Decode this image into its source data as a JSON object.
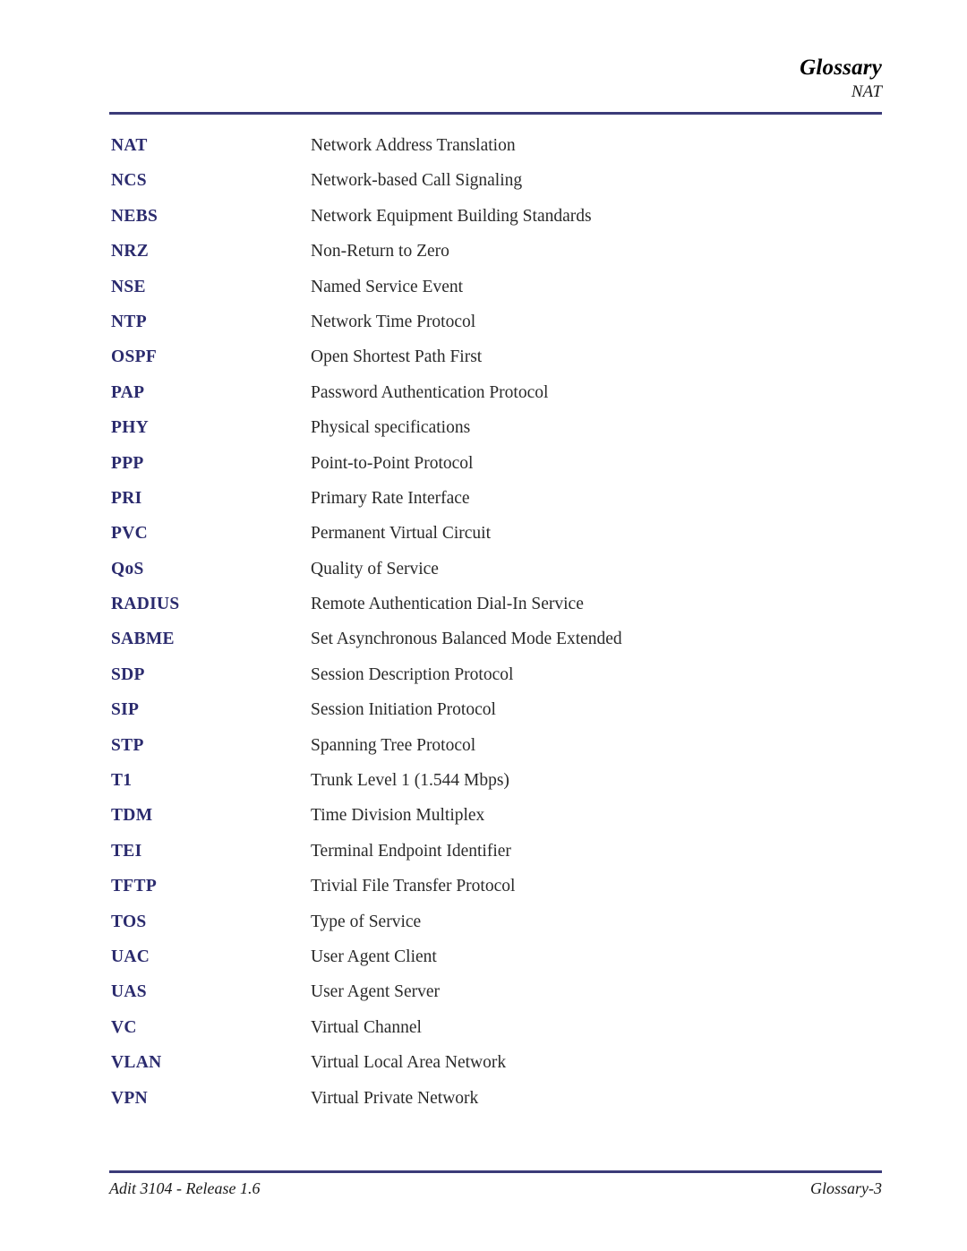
{
  "document": {
    "header": {
      "title": "Glossary",
      "subtitle": "NAT"
    },
    "footer": {
      "left": "Adit 3104 - Release 1.6",
      "right": "Glossary-3"
    },
    "colors": {
      "rule": "#3b3b78",
      "term": "#2b2b6e",
      "definition": "#2a2a2a",
      "heading": "#000000"
    },
    "entries": [
      {
        "term": "NAT",
        "definition": "Network Address Translation"
      },
      {
        "term": "NCS",
        "definition": "Network-based Call Signaling"
      },
      {
        "term": "NEBS",
        "definition": "Network Equipment Building Standards"
      },
      {
        "term": "NRZ",
        "definition": "Non-Return to Zero"
      },
      {
        "term": "NSE",
        "definition": "Named Service Event"
      },
      {
        "term": "NTP",
        "definition": "Network Time Protocol"
      },
      {
        "term": "OSPF",
        "definition": "Open Shortest Path First"
      },
      {
        "term": "PAP",
        "definition": "Password Authentication Protocol"
      },
      {
        "term": "PHY",
        "definition": "Physical specifications"
      },
      {
        "term": "PPP",
        "definition": "Point-to-Point Protocol"
      },
      {
        "term": "PRI",
        "definition": "Primary Rate Interface"
      },
      {
        "term": "PVC",
        "definition": "Permanent Virtual Circuit"
      },
      {
        "term": "QoS",
        "definition": "Quality of Service"
      },
      {
        "term": "RADIUS",
        "definition": "Remote Authentication Dial-In Service"
      },
      {
        "term": "SABME",
        "definition": "Set Asynchronous Balanced Mode Extended"
      },
      {
        "term": "SDP",
        "definition": "Session Description Protocol"
      },
      {
        "term": "SIP",
        "definition": "Session Initiation Protocol"
      },
      {
        "term": "STP",
        "definition": "Spanning Tree Protocol"
      },
      {
        "term": "T1",
        "definition": "Trunk Level 1 (1.544 Mbps)"
      },
      {
        "term": "TDM",
        "definition": "Time Division Multiplex"
      },
      {
        "term": "TEI",
        "definition": "Terminal Endpoint Identifier"
      },
      {
        "term": "TFTP",
        "definition": "Trivial File Transfer Protocol"
      },
      {
        "term": "TOS",
        "definition": "Type of Service"
      },
      {
        "term": "UAC",
        "definition": "User Agent Client"
      },
      {
        "term": "UAS",
        "definition": "User Agent Server"
      },
      {
        "term": "VC",
        "definition": "Virtual Channel"
      },
      {
        "term": "VLAN",
        "definition": "Virtual Local Area Network"
      },
      {
        "term": "VPN",
        "definition": "Virtual Private Network"
      }
    ]
  }
}
